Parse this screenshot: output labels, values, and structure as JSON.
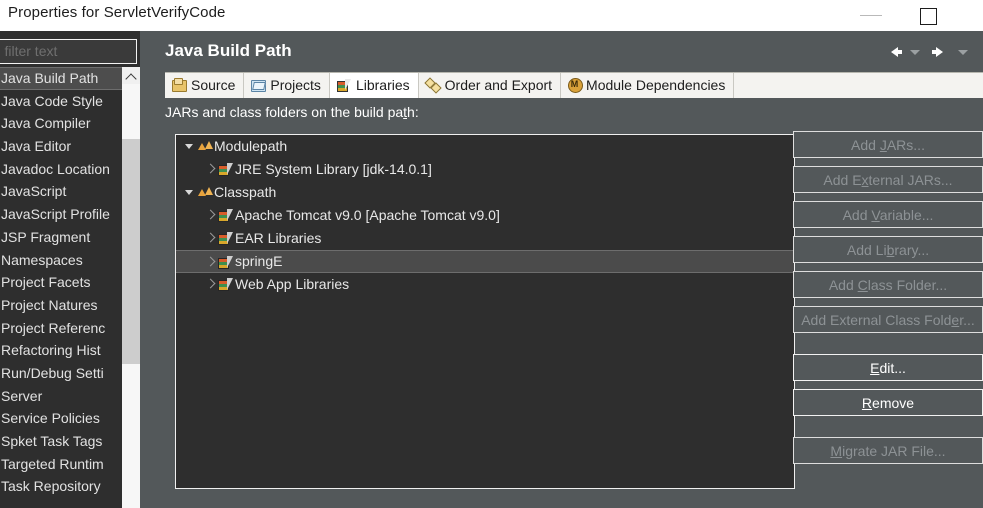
{
  "window": {
    "title": "Properties for ServletVerifyCode",
    "controls": [
      {
        "name": "minimize",
        "glyph": "—"
      },
      {
        "name": "maximize",
        "glyph": "☐"
      }
    ]
  },
  "sidebar": {
    "filter": {
      "placeholder": "pe filter text",
      "value": ""
    },
    "items": [
      {
        "label": "Java Build Path",
        "selected": true
      },
      {
        "label": "Java Code Style",
        "selected": false
      },
      {
        "label": "Java Compiler",
        "selected": false
      },
      {
        "label": "Java Editor",
        "selected": false
      },
      {
        "label": "Javadoc Location",
        "selected": false
      },
      {
        "label": "JavaScript",
        "selected": false
      },
      {
        "label": "JavaScript Profile",
        "selected": false
      },
      {
        "label": "JSP Fragment",
        "selected": false
      },
      {
        "label": "Namespaces",
        "selected": false
      },
      {
        "label": "Project Facets",
        "selected": false
      },
      {
        "label": "Project Natures",
        "selected": false
      },
      {
        "label": "Project Referenc",
        "selected": false
      },
      {
        "label": "Refactoring Hist",
        "selected": false
      },
      {
        "label": "Run/Debug Setti",
        "selected": false
      },
      {
        "label": "Server",
        "selected": false
      },
      {
        "label": "Service Policies",
        "selected": false
      },
      {
        "label": "Spket Task Tags",
        "selected": false
      },
      {
        "label": "Targeted Runtim",
        "selected": false
      },
      {
        "label": "Task Repository",
        "selected": false
      }
    ]
  },
  "main": {
    "title": "Java Build Path",
    "nav": {
      "back": "←",
      "forward": "→"
    },
    "tabs": [
      {
        "label": "Source",
        "icon": "source-folder-icon",
        "active": false
      },
      {
        "label": "Projects",
        "icon": "projects-folder-icon",
        "active": false
      },
      {
        "label": "Libraries",
        "icon": "libraries-book-icon",
        "active": true
      },
      {
        "label": "Order and Export",
        "icon": "order-export-icon",
        "active": false
      },
      {
        "label": "Module Dependencies",
        "icon": "module-badge-icon",
        "active": false
      }
    ],
    "section_label": {
      "before": "JARs and class folders on the build pa",
      "mnemonic": "t",
      "after": "h:"
    },
    "tree": [
      {
        "label": "Modulepath",
        "icon": "path-icon",
        "indent": 0,
        "twisty": "open",
        "selected": false
      },
      {
        "label": "JRE System Library [jdk-14.0.1]",
        "icon": "library-icon",
        "indent": 1,
        "twisty": "closed",
        "selected": false
      },
      {
        "label": "Classpath",
        "icon": "path-icon",
        "indent": 0,
        "twisty": "open",
        "selected": false
      },
      {
        "label": "Apache Tomcat v9.0 [Apache Tomcat v9.0]",
        "icon": "library-icon",
        "indent": 1,
        "twisty": "closed",
        "selected": false
      },
      {
        "label": "EAR Libraries",
        "icon": "library-icon",
        "indent": 1,
        "twisty": "closed",
        "selected": false
      },
      {
        "label": "springE",
        "icon": "library-icon",
        "indent": 1,
        "twisty": "closed",
        "selected": true
      },
      {
        "label": "Web App Libraries",
        "icon": "library-icon",
        "indent": 1,
        "twisty": "closed",
        "selected": false
      }
    ],
    "buttons": [
      {
        "name": "add-jars",
        "before": "Add ",
        "mnemonic": "J",
        "after": "ARs...",
        "enabled": false,
        "gap_after": false
      },
      {
        "name": "add-external-jars",
        "before": "Add E",
        "mnemonic": "x",
        "after": "ternal JARs...",
        "enabled": false,
        "gap_after": false
      },
      {
        "name": "add-variable",
        "before": "Add ",
        "mnemonic": "V",
        "after": "ariable...",
        "enabled": false,
        "gap_after": false
      },
      {
        "name": "add-library",
        "before": "Add Li",
        "mnemonic": "b",
        "after": "rary...",
        "enabled": false,
        "gap_after": false
      },
      {
        "name": "add-class-folder",
        "before": "Add ",
        "mnemonic": "C",
        "after": "lass Folder...",
        "enabled": false,
        "gap_after": false
      },
      {
        "name": "add-external-class-folder",
        "before": "Add External Class Fold",
        "mnemonic": "e",
        "after": "r...",
        "enabled": false,
        "gap_after": true
      },
      {
        "name": "edit",
        "before": "",
        "mnemonic": "E",
        "after": "dit...",
        "enabled": true,
        "gap_after": false
      },
      {
        "name": "remove",
        "before": "",
        "mnemonic": "R",
        "after": "emove",
        "enabled": true,
        "gap_after": true
      },
      {
        "name": "migrate-jar-file",
        "before": "",
        "mnemonic": "M",
        "after": "igrate JAR File...",
        "enabled": false,
        "gap_after": false
      }
    ]
  },
  "colors": {
    "panel_bg": "#53585a",
    "tree_bg": "#2e2e2e",
    "sidebar_bg": "#2e2e2e",
    "tab_bar_bg": "#f4f3f0",
    "selection_bg": "#4b4b4b",
    "title_bar_bg": "#ffffff",
    "text_light": "#e8e8e8",
    "text_disabled": "#8d9295",
    "accent_orange": "#e8a33d"
  }
}
